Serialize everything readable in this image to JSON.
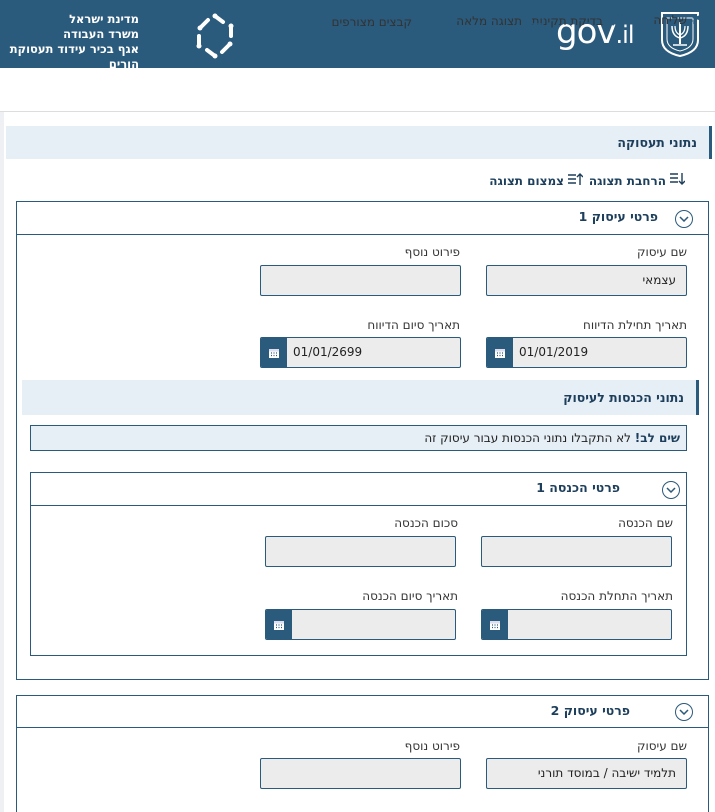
{
  "header": {
    "gov_logo": "gov",
    "gov_logo_il": ".il",
    "ministry_lines": [
      "מדינת ישראל",
      "משרד העבודה",
      "אגף בכיר עידוד תעסוקת הורים"
    ],
    "brand_color": "#2a5a7c"
  },
  "toolbar": {
    "send": "שליחה",
    "validate": "בדיקת תקינות",
    "full_view": "תצוגה מלאה",
    "attachments": "קבצים מצורפים"
  },
  "employment_section": {
    "title": "נתוני תעסוקה",
    "expand_view": "הרחבת תצוגה",
    "collapse_view": "צמצום תצוגה"
  },
  "business1": {
    "title": "פרטי עיסוק 1",
    "business_name_label": "שם עיסוק",
    "business_name_value": "עצמאי",
    "extra_label": "פירוט נוסף",
    "extra_value": "",
    "report_start_label": "תאריך תחילת הדיווח",
    "report_start_value": "01/01/2019",
    "report_end_label": "תאריך סיום הדיווח",
    "report_end_value": "01/01/2699"
  },
  "income_section": {
    "title": "נתוני הכנסות לעיסוק",
    "notice_bold": "שים לב!",
    "notice_text": " לא התקבלו נתוני הכנסות עבור עיסוק זה"
  },
  "income1": {
    "title": "פרטי הכנסה 1",
    "income_name_label": "שם הכנסה",
    "income_amount_label": "סכום הכנסה",
    "income_start_label": "תאריך התחלת הכנסה",
    "income_end_label": "תאריך סיום הכנסה"
  },
  "business2": {
    "title": "פרטי עיסוק 2",
    "business_name_label": "שם עיסוק",
    "business_name_value": "תלמיד ישיבה / במוסד תורני",
    "extra_label": "פירוט נוסף",
    "extra_value": ""
  }
}
